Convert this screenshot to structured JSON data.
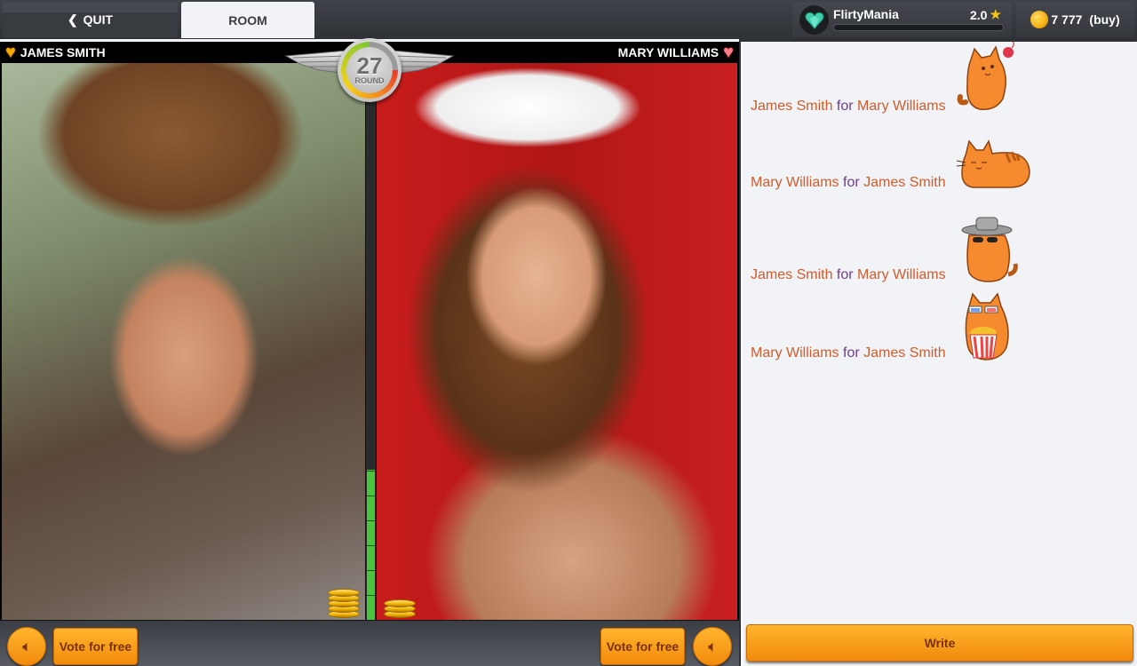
{
  "topbar": {
    "quit_label": "QUIT",
    "room_label": "ROOM",
    "profile": {
      "name": "FlirtyMania",
      "rating": "2.0",
      "avatar_icon": "gem-heart-icon"
    },
    "coins": {
      "amount": "7 777",
      "buy_label": "(buy)"
    }
  },
  "game": {
    "round": {
      "number": "27",
      "label": "ROUND",
      "timer_fraction_remaining": 0.75
    },
    "left_player": {
      "name": "JAMES SMITH",
      "heart_color": "#f5a800",
      "coin_stack_count": 5
    },
    "right_player": {
      "name": "MARY WILLIAMS",
      "heart_color": "#ff7a8a",
      "coin_stack_count": 3
    },
    "vote_meter_percent": 27,
    "footer": {
      "left_vote_label": "Vote for free",
      "right_vote_label": "Vote for free"
    }
  },
  "chat": {
    "connector": "for",
    "messages": [
      {
        "from": "James Smith",
        "to": "Mary Williams",
        "sticker": "cat-with-yarn-sticker"
      },
      {
        "from": "Mary Williams",
        "to": "James Smith",
        "sticker": "sleeping-cat-sticker"
      },
      {
        "from": "James Smith",
        "to": "Mary Williams",
        "sticker": "cat-with-hat-sunglasses-sticker"
      },
      {
        "from": "Mary Williams",
        "to": "James Smith",
        "sticker": "cat-with-popcorn-3d-glasses-sticker"
      }
    ],
    "write_label": "Write"
  },
  "colors": {
    "accent_orange": "#f7a01e",
    "chat_name": "#d05c2c",
    "chat_for": "#6e3b8c",
    "meter_green": "#4ac43c"
  }
}
